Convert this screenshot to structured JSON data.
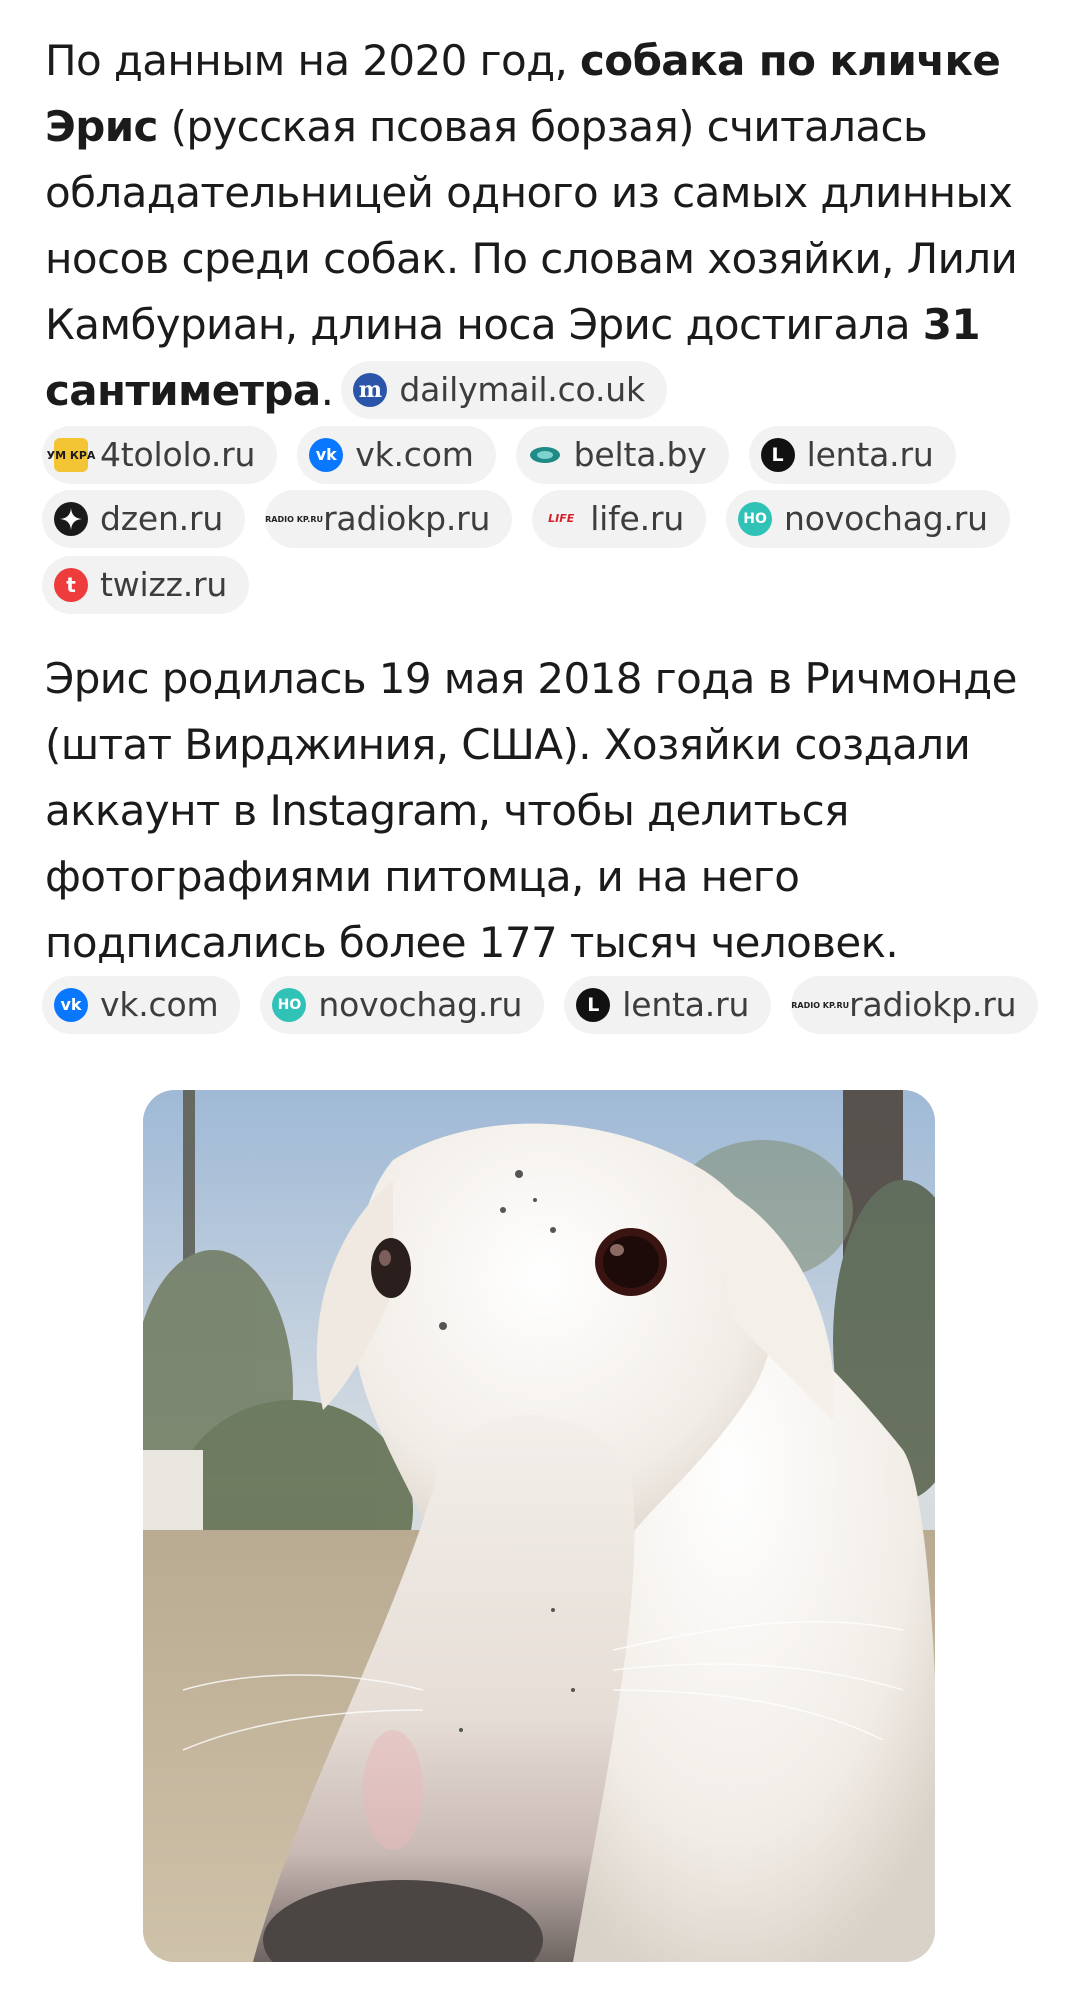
{
  "paragraph1": {
    "t1": "По данным на 2020 год, ",
    "b1": "собака по кличке Эрис",
    "t2": " (русская псовая борзая) считалась обладательницей одного из самых длинных носов среди собак. По словам хозяйки, Лили Камбуриан, длина носа Эрис достигала ",
    "b2": "31 сантиметра",
    "t3": "."
  },
  "paragraph2": {
    "text": "Эрис родилась 19 мая 2018 года в Ричмонде (штат Вирджиния, США). Хозяйки создали аккаунт в Instagram, чтобы делиться фотографиями питомца, и на него подписались более 177 тысяч человек."
  },
  "sources1": [
    {
      "label": "dailymail.co.uk",
      "icon": "dailymail-icon",
      "glyph": "m"
    },
    {
      "label": "4tololo.ru",
      "icon": "tololo-icon",
      "glyph": "УМ КРА"
    },
    {
      "label": "vk.com",
      "icon": "vk-icon",
      "glyph": "vk"
    },
    {
      "label": "belta.by",
      "icon": "belta-icon",
      "glyph": ""
    },
    {
      "label": "lenta.ru",
      "icon": "lenta-icon",
      "glyph": "L"
    },
    {
      "label": "dzen.ru",
      "icon": "dzen-icon",
      "glyph": ""
    },
    {
      "label": "radiokp.ru",
      "icon": "radiokp-icon",
      "glyph": "RADIO KP.RU"
    },
    {
      "label": "life.ru",
      "icon": "life-icon",
      "glyph": "LIFE"
    },
    {
      "label": "novochag.ru",
      "icon": "novochag-icon",
      "glyph": "НО"
    },
    {
      "label": "twizz.ru",
      "icon": "twizz-icon",
      "glyph": "t"
    }
  ],
  "sources2": [
    {
      "label": "vk.com",
      "icon": "vk-icon",
      "glyph": "vk"
    },
    {
      "label": "novochag.ru",
      "icon": "novochag-icon",
      "glyph": "НО"
    },
    {
      "label": "lenta.ru",
      "icon": "lenta-icon",
      "glyph": "L"
    },
    {
      "label": "radiokp.ru",
      "icon": "radiokp-icon",
      "glyph": "RADIO KP.RU"
    }
  ],
  "colors": {
    "chip_bg": "#f2f2f3",
    "text": "#1b1b1b",
    "vk": "#0a77ff",
    "novochag": "#30c2b6",
    "twizz": "#ee3b3b"
  }
}
